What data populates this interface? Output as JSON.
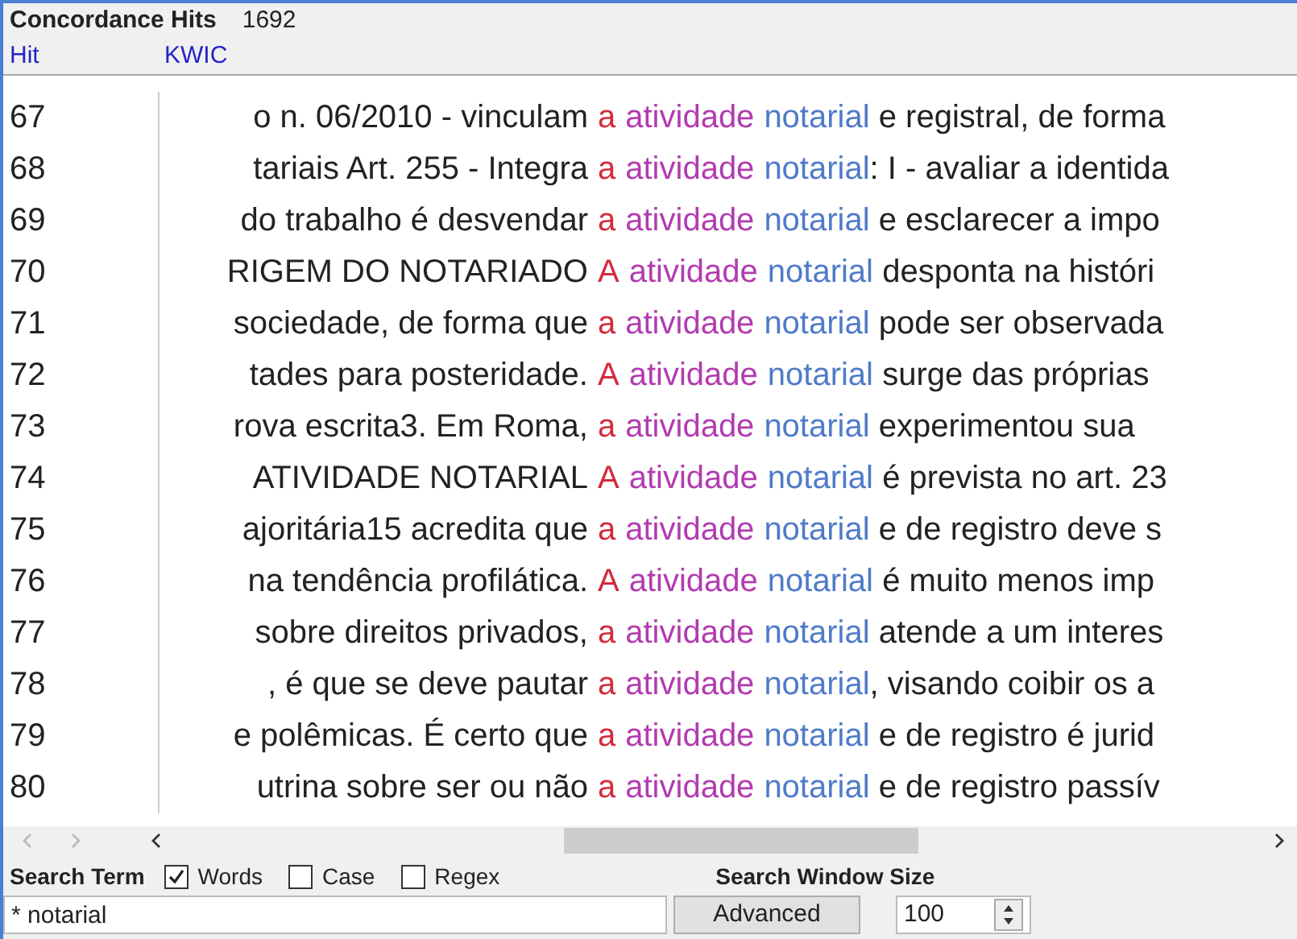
{
  "header": {
    "title": "Concordance Hits",
    "count": "1692"
  },
  "columns": [
    "Hit",
    "KWIC"
  ],
  "rows": [
    {
      "hit": "67",
      "left": "o n. 06/2010 - vinculam",
      "node": "a",
      "word_1": "atividade",
      "word_2": "notarial",
      "right": " e registral, de forma"
    },
    {
      "hit": "68",
      "left": "tariais Art. 255 - Integra",
      "node": "a",
      "word_1": "atividade",
      "word_2": "notarial",
      "right": ": I - avaliar a identida"
    },
    {
      "hit": "69",
      "left": "do trabalho é desvendar",
      "node": "a",
      "word_1": "atividade",
      "word_2": "notarial",
      "right": " e esclarecer a impo"
    },
    {
      "hit": "70",
      "left": "RIGEM DO NOTARIADO",
      "node": "A",
      "word_1": "atividade",
      "word_2": "notarial",
      "right": " desponta na históri"
    },
    {
      "hit": "71",
      "left": "sociedade, de forma que",
      "node": "a",
      "word_1": "atividade",
      "word_2": "notarial",
      "right": " pode ser observada"
    },
    {
      "hit": "72",
      "left": "tades para posteridade.",
      "node": "A",
      "word_1": "atividade",
      "word_2": "notarial",
      "right": " surge das próprias"
    },
    {
      "hit": "73",
      "left": "rova escrita3. Em Roma,",
      "node": "a",
      "word_1": "atividade",
      "word_2": "notarial",
      "right": " experimentou sua"
    },
    {
      "hit": "74",
      "left": "ATIVIDADE NOTARIAL",
      "node": "A",
      "word_1": "atividade",
      "word_2": "notarial",
      "right": " é prevista no art. 23"
    },
    {
      "hit": "75",
      "left": "ajoritária15 acredita que",
      "node": "a",
      "word_1": "atividade",
      "word_2": "notarial",
      "right": " e de registro deve s"
    },
    {
      "hit": "76",
      "left": "na tendência profilática.",
      "node": "A",
      "word_1": "atividade",
      "word_2": "notarial",
      "right": " é muito menos imp"
    },
    {
      "hit": "77",
      "left": "sobre direitos privados,",
      "node": "a",
      "word_1": "atividade",
      "word_2": "notarial",
      "right": " atende a um interes"
    },
    {
      "hit": "78",
      "left": ", é que se deve pautar",
      "node": "a",
      "word_1": "atividade",
      "word_2": "notarial",
      "right": ", visando coibir os a"
    },
    {
      "hit": "79",
      "left": "e polêmicas. É certo que",
      "node": "a",
      "word_1": "atividade",
      "word_2": "notarial",
      "right": " e de registro é jurid"
    },
    {
      "hit": "80",
      "left": "utrina sobre ser ou não",
      "node": "a",
      "word_1": "atividade",
      "word_2": "notarial",
      "right": " e de registro passív"
    }
  ],
  "search": {
    "label": "Search Term",
    "options": [
      {
        "label": "Words",
        "checked": true
      },
      {
        "label": "Case",
        "checked": false
      },
      {
        "label": "Regex",
        "checked": false
      }
    ],
    "value": "* notarial",
    "button": "Advanced"
  },
  "window_size": {
    "label": "Search Window Size",
    "value": "100"
  }
}
